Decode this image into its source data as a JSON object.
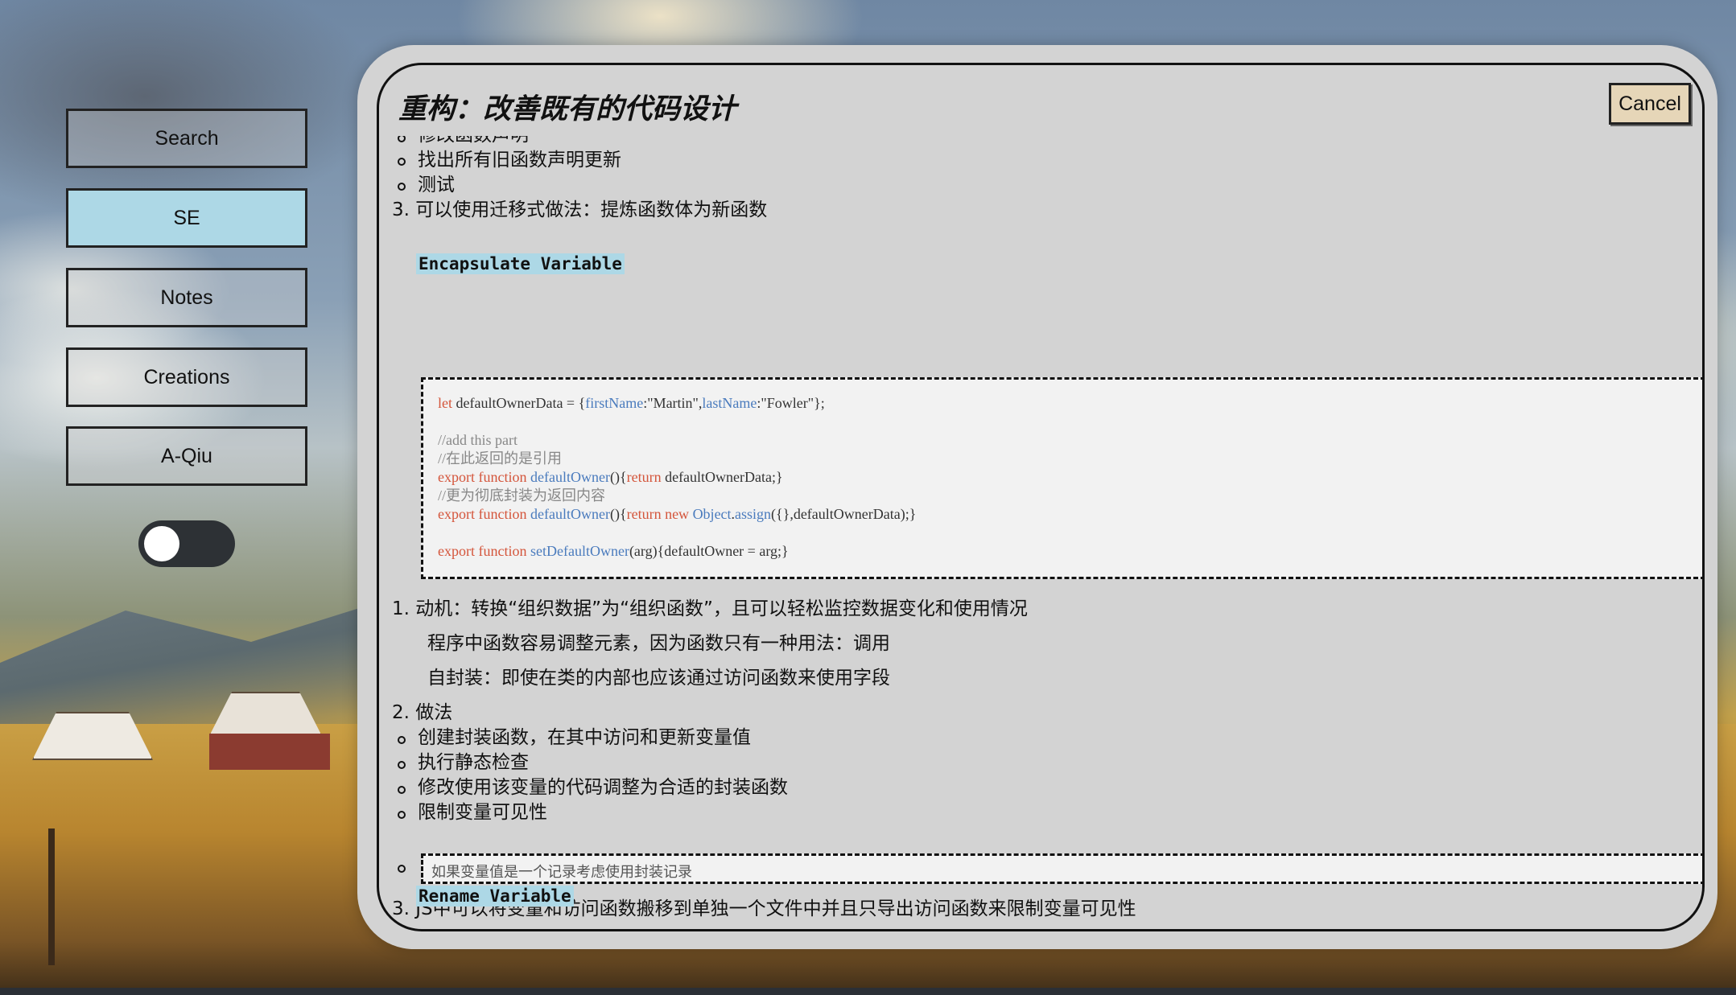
{
  "sidebar": {
    "items": [
      {
        "label": "Search"
      },
      {
        "label": "SE"
      },
      {
        "label": "Notes"
      },
      {
        "label": "Creations"
      },
      {
        "label": "A-Qiu"
      }
    ],
    "active_item": "SE",
    "active_color": "#add8e6",
    "toggle_state": "off"
  },
  "modal": {
    "title": "重构：改善既有的代码设计",
    "cancel_label": "Cancel",
    "cancel_color": "#e6d6b8",
    "top_list": {
      "sub_items": [
        "修改函数声明",
        "找出所有旧函数声明更新",
        "测试"
      ],
      "item3": "3. 可以使用迁移式做法：提炼函数体为新函数"
    },
    "section1": {
      "heading": "Encapsulate Variable",
      "code_lines": [
        "let defaultOwnerData = {firstName:\"Martin\",lastName:\"Fowler\"};",
        "",
        "//add this part",
        "//在此返回的是引用",
        "export function defaultOwner(){return defaultOwnerData;}",
        "//更为彻底封装为返回内容",
        "export function defaultOwner(){return new Object.assign({},defaultOwnerData);}",
        "",
        "export function setDefaultOwner(arg){defaultOwner = arg;}"
      ],
      "item1": "1. 动机：转换“组织数据”为“组织函数”，且可以轻松监控数据变化和使用情况",
      "item1_para1": "程序中函数容易调整元素，因为函数只有一种用法：调用",
      "item1_para2": "自封装：即使在类的内部也应该通过访问函数来使用字段",
      "item2": "2. 做法",
      "steps": [
        "创建封装函数，在其中访问和更新变量值",
        "执行静态检查",
        "修改使用该变量的代码调整为合适的封装函数",
        "限制变量可见性"
      ],
      "note_box": "如果变量值是一个记录考虑使用封装记录",
      "item3": "3. JS中可以将变量和访问函数搬移到单独一个文件中并且只导出访问函数来限制变量可见性"
    },
    "section2": {
      "heading": "Rename Variable"
    }
  },
  "colors": {
    "modal_bg": "#d3d3d3",
    "heading_highlight": "#add8e6",
    "code_keyword": "#d4553b",
    "code_function": "#4a7bbd",
    "code_comment": "#888888"
  }
}
